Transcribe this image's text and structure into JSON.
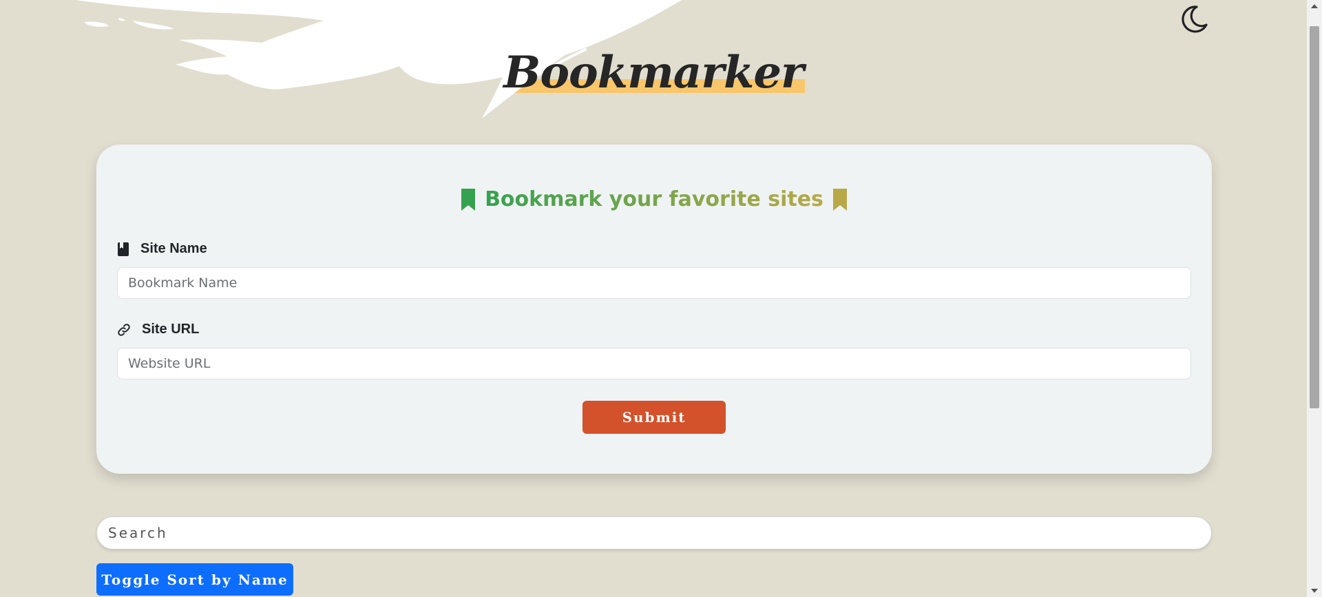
{
  "app": {
    "title": "Bookmarker"
  },
  "header": {
    "theme_toggle_icon": "moon-icon"
  },
  "form": {
    "heading": "Bookmark your favorite sites",
    "heading_icon": "bookmark-icon",
    "site_name": {
      "label": "Site Name",
      "icon": "book-icon",
      "value": "",
      "placeholder": "Bookmark Name"
    },
    "site_url": {
      "label": "Site URL",
      "icon": "link-icon",
      "value": "",
      "placeholder": "Website URL"
    },
    "submit_label": "Submit"
  },
  "search": {
    "value": "",
    "placeholder": "Search"
  },
  "sort": {
    "label": "Toggle Sort by Name"
  },
  "colors": {
    "background": "#e1ded0",
    "card": "#f0f3f4",
    "title_highlight": "#f8c66b",
    "heading_gradient_start": "#35a24f",
    "heading_gradient_end": "#b8a947",
    "submit": "#d3512b",
    "sort_button": "#0d6efd"
  }
}
